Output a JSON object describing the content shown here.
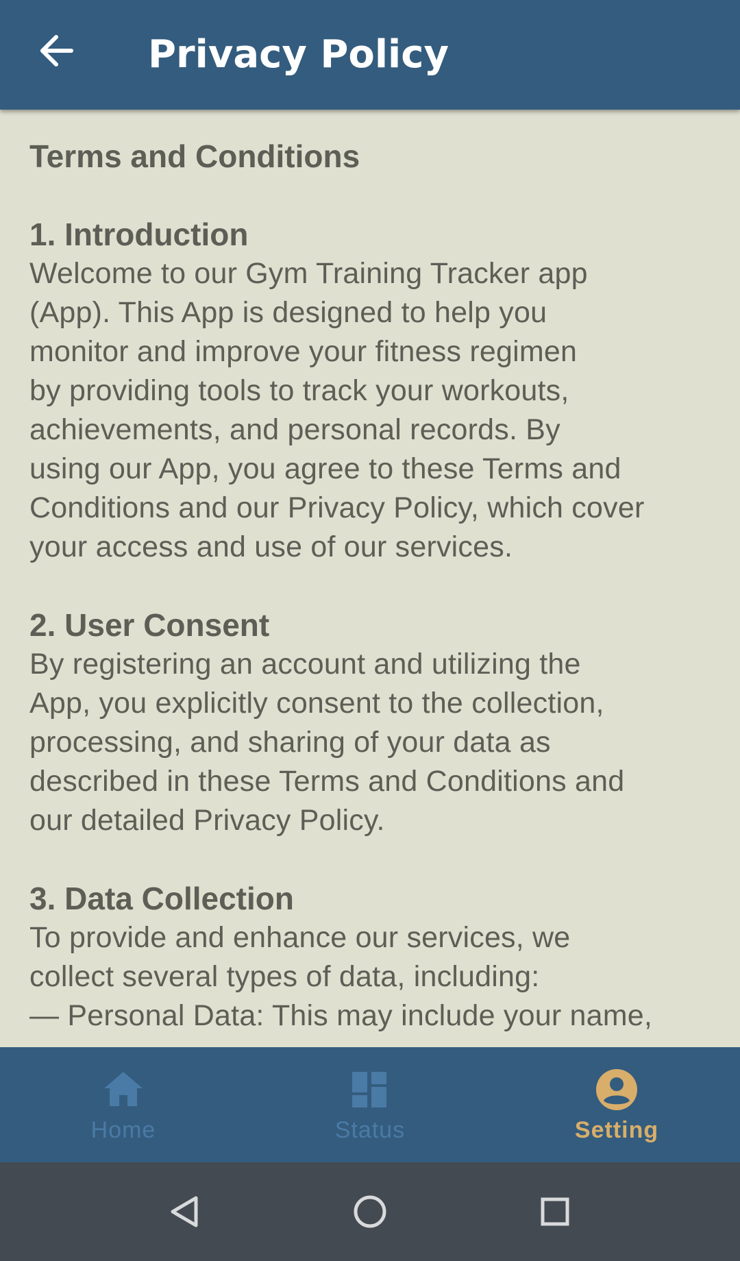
{
  "header": {
    "title": "Privacy Policy",
    "back_icon": "arrow-back-icon",
    "background": "#345c7e"
  },
  "document": {
    "title": "Terms and Conditions",
    "sections": [
      {
        "heading": "1. Introduction",
        "lines": [
          "Welcome to our Gym Training Tracker app",
          "(App). This App is designed to help you",
          "monitor and improve your fitness regimen",
          "by providing tools to track your workouts,",
          "achievements, and personal records. By",
          "using our App, you agree to these Terms and",
          "Conditions and our Privacy Policy, which cover",
          "your access and use of our services."
        ]
      },
      {
        "heading": "2. User Consent",
        "lines": [
          "By registering an account and utilizing the",
          "App, you explicitly consent to the collection,",
          "processing, and sharing of your data as",
          "described in these Terms and Conditions and",
          "our detailed Privacy Policy."
        ]
      },
      {
        "heading": "3. Data Collection",
        "lines": [
          "To provide and enhance our services, we",
          "collect several types of data, including:",
          "— Personal Data: This may include your name,"
        ]
      }
    ]
  },
  "bottom_nav": {
    "items": [
      {
        "label": "Home",
        "icon": "home-icon",
        "active": false
      },
      {
        "label": "Status",
        "icon": "dashboard-icon",
        "active": false
      },
      {
        "label": "Setting",
        "icon": "account-circle-icon",
        "active": true
      }
    ],
    "active_color": "#d8ae6a",
    "inactive_color": "#4a7aa6"
  },
  "system_nav": {
    "buttons": [
      "back-triangle-icon",
      "home-circle-icon",
      "recents-square-icon"
    ]
  }
}
